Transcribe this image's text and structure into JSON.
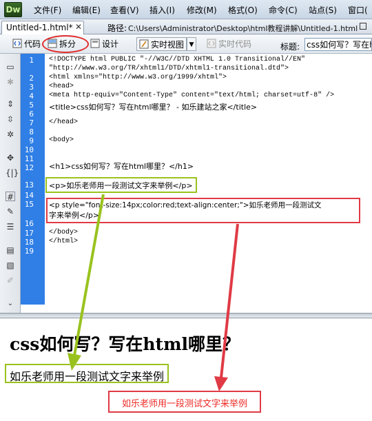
{
  "app": {
    "logo": "Dw",
    "menus": [
      "文件(F)",
      "编辑(E)",
      "查看(V)",
      "插入(I)",
      "修改(M)",
      "格式(O)",
      "命令(C)",
      "站点(S)",
      "窗口("
    ]
  },
  "document": {
    "tab_label": "Untitled-1.html*",
    "path_label": "路径:",
    "path_value": "C:\\Users\\Administrator\\Desktop\\html教程讲解\\Untitled-1.html"
  },
  "toolbar": {
    "code_label": "代码",
    "split_label": "拆分",
    "design_label": "设计",
    "live_view_label": "实时视图",
    "live_code_label": "实时代码",
    "title_label": "标题:",
    "title_value": "css如何写？写在h"
  },
  "code": {
    "line_numbers": [
      "1",
      "2",
      "3",
      "4",
      "5",
      "6",
      "7",
      "8",
      "9",
      "10",
      "11",
      "12",
      "13",
      "14",
      "15",
      "16",
      "17",
      "18",
      "19"
    ],
    "lines": [
      "<!DOCTYPE html PUBLIC \"-//W3C//DTD XHTML 1.0 Transitional//EN\"",
      "\"http://www.w3.org/TR/xhtml1/DTD/xhtml1-transitional.dtd\">",
      "<html xmlns=\"http://www.w3.org/1999/xhtml\">",
      "<head>",
      "<meta http-equiv=\"Content-Type\" content=\"text/html; charset=utf-8\" />",
      "<title>css如何写？写在html哪里？ - 如乐建站之家</title>",
      "",
      "</head>",
      "",
      "<body>",
      "",
      "<h1>css如何写？写在html哪里？</h1>",
      "",
      "<p>如乐老师用一段测试文字来举例</p>",
      "",
      "<p style=\"font-size:14px;color:red;text-align:center;\">如乐老师用一段测试文",
      "字来举例</p>",
      "",
      "</body>",
      "</html>",
      ""
    ]
  },
  "design": {
    "h1": "css如何写？写在html哪里？",
    "p1": "如乐老师用一段测试文字来举例",
    "p2": "如乐老师用一段测试文字来举例"
  },
  "colors": {
    "gutter": "#2f7fe6",
    "highlight_green": "#99c21e",
    "highlight_red": "#e03a45",
    "red_text": "#ee2a24"
  }
}
